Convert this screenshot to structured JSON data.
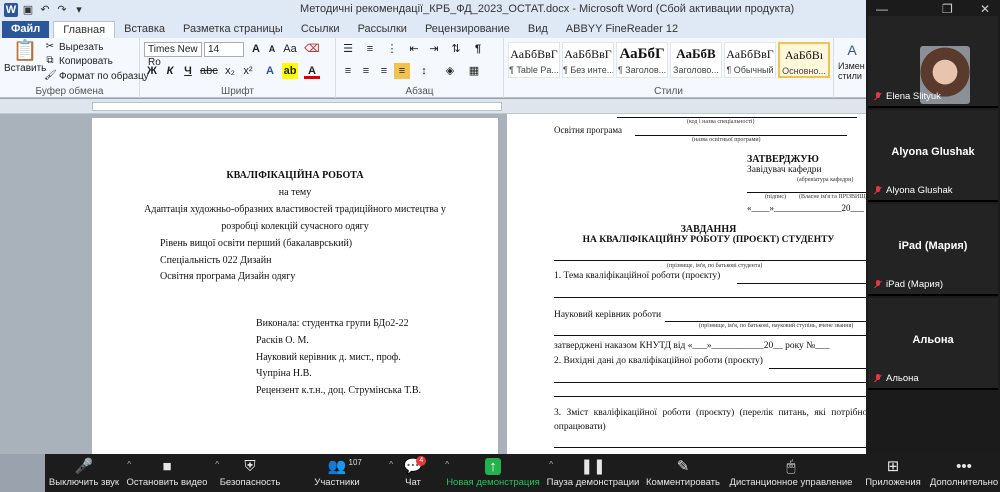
{
  "window": {
    "title": "Методичні рекомендації_КРБ_ФД_2023_ОСТАТ.docx - Microsoft Word (Сбой активации продукта)"
  },
  "tabs": [
    {
      "label": "Файл"
    },
    {
      "label": "Главная"
    },
    {
      "label": "Вставка"
    },
    {
      "label": "Разметка страницы"
    },
    {
      "label": "Ссылки"
    },
    {
      "label": "Рассылки"
    },
    {
      "label": "Рецензирование"
    },
    {
      "label": "Вид"
    },
    {
      "label": "ABBYY FineReader 12"
    }
  ],
  "ribbon": {
    "paste": "Вставить",
    "cut": "Вырезать",
    "copy": "Копировать",
    "format_painter": "Формат по образцу",
    "clipboard_label": "Буфер обмена",
    "font_label": "Шрифт",
    "paragraph_label": "Абзац",
    "styles_label": "Стили",
    "font_name": "Times New Ro",
    "font_size": "14",
    "change_styles": "Измен стили",
    "styles": [
      {
        "preview": "АаБбВвГ",
        "name": "¶ Table Pa..."
      },
      {
        "preview": "АаБбВвГ",
        "name": "¶ Без инте..."
      },
      {
        "preview": "АаБбГ",
        "name": "¶ Заголов..."
      },
      {
        "preview": "АаБбВ",
        "name": "Заголово..."
      },
      {
        "preview": "АаБбВвГ",
        "name": "¶ Обычный"
      },
      {
        "preview": "АаБбВı",
        "name": "Основно..."
      }
    ]
  },
  "page1": {
    "heading": "КВАЛІФІКАЦІЙНА РОБОТА",
    "on_topic": "на тему",
    "topic1": "Адаптація художньо-образних властивостей традиційного мистецтва у",
    "topic2": "розробці колекцій сучасного одягу",
    "level": "Рівень вищої освіти перший (бакалаврський)",
    "specialty": "Спеціальність  022 Дизайн",
    "program": "Освітня програма Дизайн одягу",
    "performed": "Виконала: студентка групи БДо2-22",
    "student": "Расків О. М.",
    "supervisor": "Науковий керівник д. мист., проф.",
    "supervisor_name": "Чупріна Н.В.",
    "reviewer": "Рецензент к.т.н., доц. Струмінська Т.В."
  },
  "page2": {
    "hint_spec": "(код і назва спеціальності)",
    "program": "Освітня програма",
    "hint_program": "(назва освітньої програми)",
    "approve": "ЗАТВЕРДЖУЮ",
    "head": "Завідувач кафедри",
    "hint_abbr": "(абревіатура кафедри)",
    "hint_sign": "(підпис)",
    "hint_name": "(Власне ім'я та ПРІЗВИЩЕ)",
    "date_line": "«____»_______________20___",
    "task": "ЗАВДАННЯ",
    "task_sub": "НА КВАЛІФІКАЦІЙНУ РОБОТУ (ПРОЄКТ) СТУДЕНТУ",
    "hint_student": "(прізвище, ім'я, по батькові студента)",
    "item1": "1. Тема кваліфікаційної роботи (проєкту)",
    "supervisor": "Науковий керівник роботи",
    "hint_supervisor": "(прізвище, ім'я, по батькові, науковий ступінь, вчене звання)",
    "order": "затверджені наказом КНУТД від «___»___________20__ року №___",
    "item2": "2. Вихідні дані до кваліфікаційної роботи (проєкту)",
    "item3a": "3. Зміст кваліфікаційної роботи (проєкту) (перелік питань, які потрібно",
    "item3b": "опрацювати)"
  },
  "participants": [
    {
      "name": "Elena Slityuk"
    },
    {
      "name": "Alyona Glushak",
      "big": "Alyona Glushak"
    },
    {
      "name": "iPad (Мария)",
      "big": "iPad (Мария)"
    },
    {
      "name": "Альона",
      "big": "Альона"
    }
  ],
  "toolbar": {
    "mute": "Выключить звук",
    "video": "Остановить видео",
    "security": "Безопасность",
    "participants": "Участники",
    "participants_count": "107",
    "chat": "Чат",
    "chat_badge": "4",
    "share": "Новая демонстрация",
    "pause": "Пауза демонстрации",
    "annotate": "Комментировать",
    "remote": "Дистанционное управление",
    "apps": "Приложения",
    "more": "Дополнительно"
  },
  "colors": {
    "accent": "#2b579a",
    "share_green": "#22b14c",
    "mute_red": "#e5383b"
  }
}
